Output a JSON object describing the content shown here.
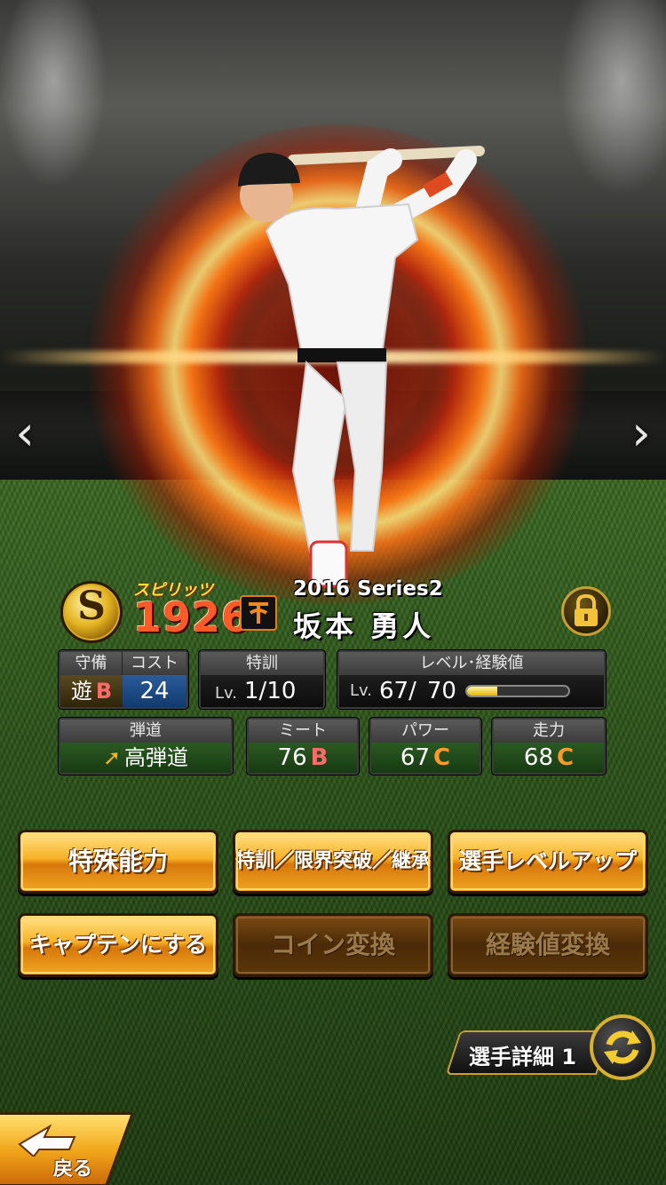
{
  "card": {
    "spirits_icon": "S",
    "spirits_label": "スピリッツ",
    "spirits_value": "1926",
    "team_logo": "giants-logo",
    "series": "2016 Series2",
    "player_name": "坂本 勇人",
    "lock_icon": "padlock-icon"
  },
  "stats": {
    "position": {
      "label": "守備",
      "value": "遊",
      "grade": "B"
    },
    "cost": {
      "label": "コスト",
      "value": "24"
    },
    "training": {
      "label": "特訓",
      "lv_prefix": "Lv.",
      "value": "1/10"
    },
    "level": {
      "label": "レベル･経験値",
      "lv_prefix": "Lv.",
      "current": "67/",
      "max": "70",
      "exp_fraction": 0.3
    },
    "trajectory": {
      "label": "弾道",
      "value": "高弾道"
    },
    "meet": {
      "label": "ミート",
      "value": "76",
      "grade": "B"
    },
    "power": {
      "label": "パワー",
      "value": "67",
      "grade": "C"
    },
    "speed": {
      "label": "走力",
      "value": "68",
      "grade": "C"
    }
  },
  "buttons": {
    "special_ability": "特殊能力",
    "training_limit": "特訓／限界突破／継承",
    "level_up": "選手レベルアップ",
    "captain": "キャプテンにする",
    "coin_exchange": "コイン変換",
    "exp_exchange": "経験値変換"
  },
  "footer": {
    "detail_label": "選手詳細 1",
    "refresh_icon": "refresh-icon",
    "back_label": "戻る"
  },
  "nav": {
    "prev": "‹",
    "next": "›"
  },
  "colors": {
    "gold_button": "#f7b125",
    "dim_button": "#4a2a08",
    "grade_b": "#ff6a6a",
    "grade_c": "#ff9a2a",
    "exp_bar": "#f0d020"
  }
}
